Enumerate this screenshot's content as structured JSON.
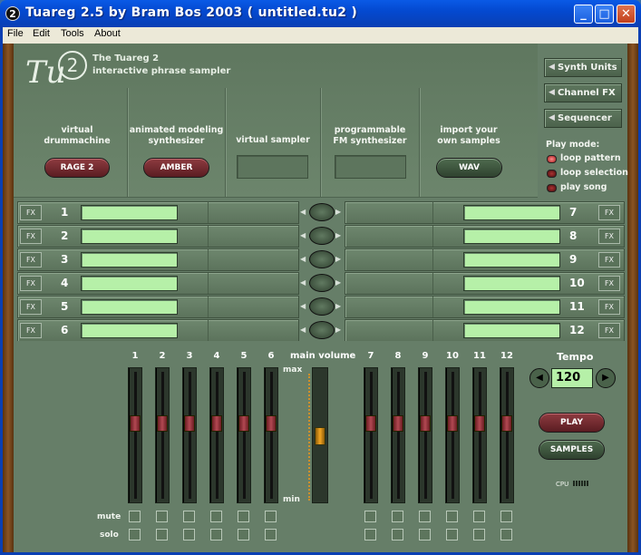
{
  "window": {
    "title": "Tuareg 2.5 by Bram Bos 2003   ( untitled.tu2 )",
    "icon_text": "2",
    "minimize": "_",
    "maximize": "□",
    "close": "✕"
  },
  "menu": [
    "File",
    "Edit",
    "Tools",
    "About"
  ],
  "brand": {
    "logo_text": "Tu",
    "logo_sup": "2",
    "line1": "The Tuareg 2",
    "line2": "interactive phrase sampler"
  },
  "sources": [
    {
      "label_l1": "virtual",
      "label_l2": "drummachine",
      "button": "RAGE 2",
      "kind": "red"
    },
    {
      "label_l1": "animated modeling",
      "label_l2": "synthesizer",
      "button": "AMBER",
      "kind": "red"
    },
    {
      "label_l1": "virtual sampler",
      "label_l2": "",
      "button": "",
      "kind": "slot"
    },
    {
      "label_l1": "programmable",
      "label_l2": "FM synthesizer",
      "button": "",
      "kind": "slot"
    },
    {
      "label_l1": "import your",
      "label_l2": "own samples",
      "button": "WAV",
      "kind": "green"
    }
  ],
  "sidebar": {
    "buttons": [
      "Synth Units",
      "Channel FX",
      "Sequencer"
    ],
    "arrow": "◀",
    "play_mode_label": "Play mode:",
    "play_modes": [
      {
        "label": "loop pattern",
        "active": true
      },
      {
        "label": "loop selection",
        "active": false
      },
      {
        "label": "play song",
        "active": false
      }
    ]
  },
  "tracks": {
    "fx_label": "FX",
    "left": [
      "1",
      "2",
      "3",
      "4",
      "5",
      "6"
    ],
    "right": [
      "7",
      "8",
      "9",
      "10",
      "11",
      "12"
    ],
    "arrow_left": "◀",
    "arrow_right": "▶"
  },
  "mixer": {
    "left_channels": [
      "1",
      "2",
      "3",
      "4",
      "5",
      "6"
    ],
    "right_channels": [
      "7",
      "8",
      "9",
      "10",
      "11",
      "12"
    ],
    "main_volume_label": "main volume",
    "max_label": "max",
    "min_label": "min",
    "mute_label": "mute",
    "solo_label": "solo"
  },
  "transport": {
    "tempo_label": "Tempo",
    "tempo_value": "120",
    "tempo_down": "◀",
    "tempo_up": "▶",
    "play": "PLAY",
    "samples": "SAMPLES",
    "cpu_label": "CPU"
  }
}
